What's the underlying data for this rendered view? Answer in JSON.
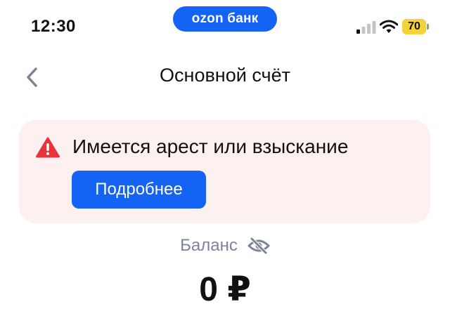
{
  "status_bar": {
    "time": "12:30",
    "brand": "ozon банк",
    "battery": "70"
  },
  "header": {
    "title": "Основной счёт"
  },
  "alert": {
    "message": "Имеется арест или взыскание",
    "button_label": "Подробнее"
  },
  "balance": {
    "label": "Баланс",
    "amount": "0 ₽"
  },
  "colors": {
    "accent": "#1463f5",
    "alert_background": "#fdf0f0",
    "alert_icon": "#e8323c",
    "battery": "#f3d23a",
    "muted_text": "#7c8596"
  },
  "icons": {
    "back": "chevron-left-icon",
    "warning": "warning-triangle-icon",
    "eye": "eye-slash-icon",
    "signal": "cellular-signal-icon",
    "wifi": "wifi-icon"
  }
}
